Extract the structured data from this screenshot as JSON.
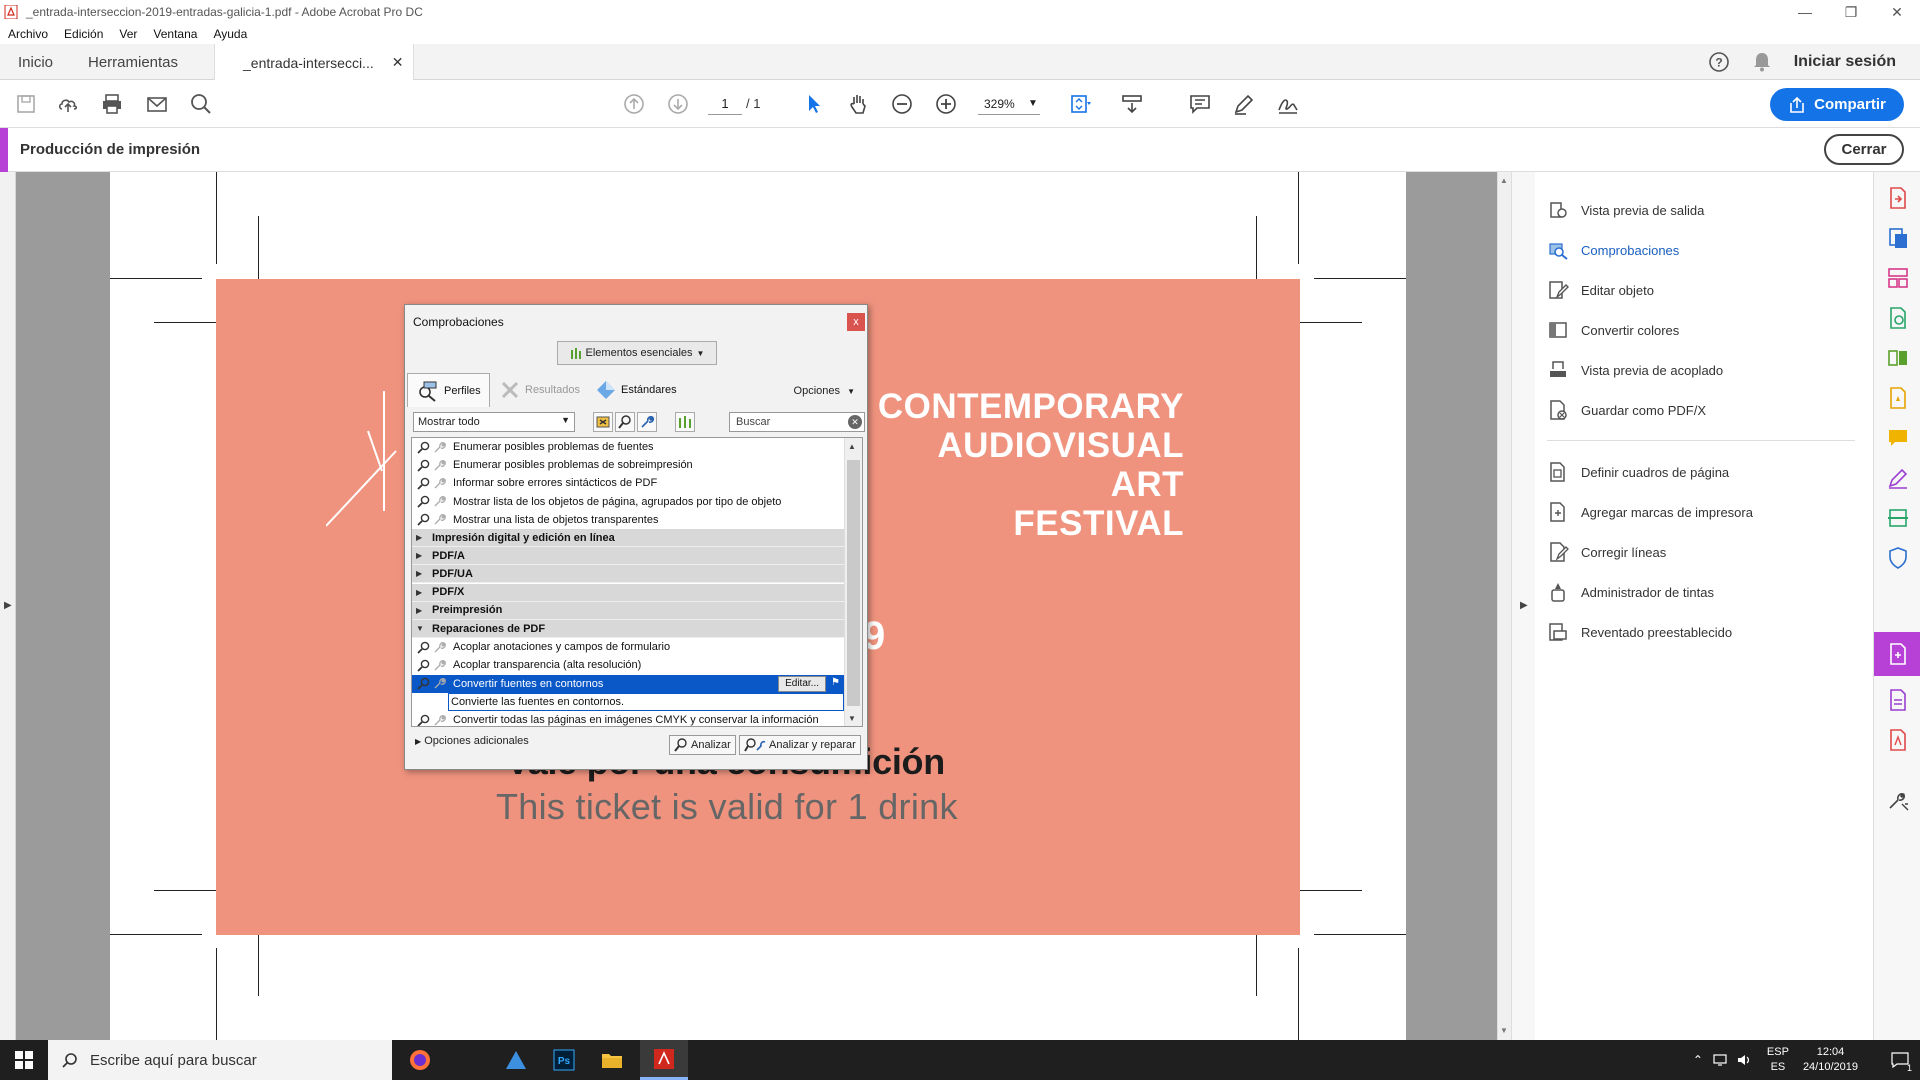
{
  "window": {
    "title": "_entrada-interseccion-2019-entradas-galicia-1.pdf - Adobe Acrobat Pro DC",
    "minimize": "—",
    "restore": "❐",
    "close": "✕"
  },
  "menu": [
    "Archivo",
    "Edición",
    "Ver",
    "Ventana",
    "Ayuda"
  ],
  "tabs": {
    "home": "Inicio",
    "tools": "Herramientas",
    "document": "_entrada-intersecci...",
    "document_close": "✕",
    "login": "Iniciar sesión"
  },
  "toolbar": {
    "page_current": "1",
    "page_total": "/ 1",
    "zoom": "329%",
    "share": "Compartir"
  },
  "tool_header": {
    "name": "Producción de impresión",
    "close": "Cerrar"
  },
  "artwork": {
    "festival_lines": [
      "CONTEMPORARY",
      "AUDIOVISUAL",
      "ART",
      "FESTIVAL"
    ],
    "year_fragment": "9",
    "vale": "Vale por una consumición",
    "ticket": "This ticket is valid for 1 drink"
  },
  "right_panel": {
    "group1": [
      {
        "label": "Vista previa de salida",
        "icon": "output-preview-icon"
      },
      {
        "label": "Comprobaciones",
        "icon": "preflight-icon",
        "active": true
      },
      {
        "label": "Editar objeto",
        "icon": "edit-object-icon"
      },
      {
        "label": "Convertir colores",
        "icon": "convert-colors-icon"
      },
      {
        "label": "Vista previa de acoplado",
        "icon": "flattener-preview-icon"
      },
      {
        "label": "Guardar como PDF/X",
        "icon": "save-pdfx-icon"
      }
    ],
    "group2": [
      {
        "label": "Definir cuadros de página",
        "icon": "page-boxes-icon"
      },
      {
        "label": "Agregar marcas de impresora",
        "icon": "printer-marks-icon"
      },
      {
        "label": "Corregir líneas",
        "icon": "fix-hairlines-icon"
      },
      {
        "label": "Administrador de tintas",
        "icon": "ink-manager-icon"
      },
      {
        "label": "Reventado preestablecido",
        "icon": "trap-presets-icon"
      }
    ]
  },
  "dialog": {
    "title": "Comprobaciones",
    "close": "x",
    "essentials": "Elementos esenciales",
    "tabs": {
      "profiles": "Perfiles",
      "results": "Resultados",
      "standards": "Estándares"
    },
    "options": "Opciones",
    "filter": "Mostrar todo",
    "search_placeholder": "Buscar",
    "rows": [
      {
        "type": "item",
        "text": "Enumerar posibles problemas de fuentes"
      },
      {
        "type": "item",
        "text": "Enumerar posibles problemas de sobreimpresión"
      },
      {
        "type": "item",
        "text": "Informar sobre errores sintácticos de PDF"
      },
      {
        "type": "item",
        "text": "Mostrar lista de los objetos de página, agrupados por tipo de objeto"
      },
      {
        "type": "item",
        "text": "Mostrar una lista de objetos transparentes"
      },
      {
        "type": "group",
        "text": "Impresión digital y edición en línea",
        "open": false
      },
      {
        "type": "group",
        "text": "PDF/A",
        "open": false
      },
      {
        "type": "group",
        "text": "PDF/UA",
        "open": false
      },
      {
        "type": "group",
        "text": "PDF/X",
        "open": false
      },
      {
        "type": "group",
        "text": "Preimpresión",
        "open": false
      },
      {
        "type": "group",
        "text": "Reparaciones de PDF",
        "open": true
      },
      {
        "type": "item",
        "text": "Acoplar anotaciones y campos de formulario"
      },
      {
        "type": "item",
        "text": "Acoplar transparencia (alta resolución)"
      },
      {
        "type": "selected",
        "text": "Convertir fuentes en contornos",
        "edit": "Editar..."
      },
      {
        "type": "desc",
        "text": "Convierte las fuentes en contornos."
      },
      {
        "type": "item",
        "text": "Convertir todas las páginas en imágenes CMYK y conservar la información"
      }
    ],
    "more_options": "Opciones adicionales",
    "analyze": "Analizar",
    "analyze_fix": "Analizar y reparar"
  },
  "taskbar": {
    "search": "Escribe aquí para buscar",
    "lang_top": "ESP",
    "lang_bottom": "ES",
    "time": "12:04",
    "date": "24/10/2019",
    "notifications": "1"
  },
  "colors": {
    "artwork": "#ef937e",
    "accent_tool": "#b740d6",
    "share_blue": "#1473e6",
    "selection": "#0a58c8"
  }
}
